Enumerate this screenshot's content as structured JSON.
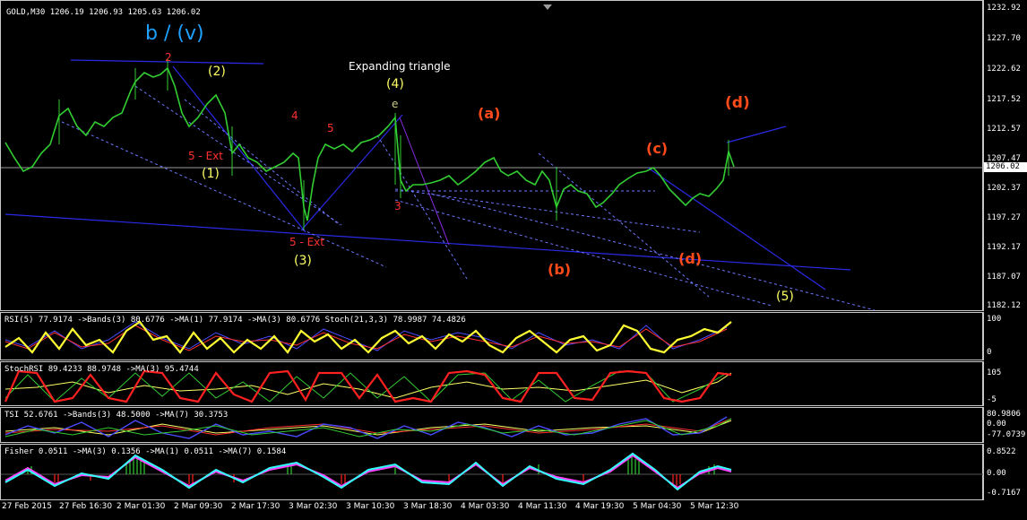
{
  "chart": {
    "title": "GOLD,M30  1206.19 1206.93 1205.63 1206.02",
    "current_price": "1206.02",
    "price_ticks": [
      "1232.92",
      "1227.70",
      "1222.62",
      "1217.52",
      "1212.57",
      "1207.47",
      "1202.37",
      "1197.27",
      "1192.17",
      "1187.07",
      "1182.12"
    ],
    "time_labels": [
      "27 Feb 2015",
      "27 Feb 16:30",
      "2 Mar 01:30",
      "2 Mar 09:30",
      "2 Mar 17:30",
      "3 Mar 02:30",
      "3 Mar 10:30",
      "3 Mar 18:30",
      "4 Mar 03:30",
      "4 Mar 11:30",
      "4 Mar 19:30",
      "5 Mar 04:30",
      "5 Mar 12:30"
    ],
    "annotations": {
      "bv": "b / (v)",
      "expanding": "Expanding triangle",
      "w4": "(4)",
      "w2": "(2)",
      "w1": "(1)",
      "w3": "(3)",
      "w5": "(5)",
      "a": "(a)",
      "b": "(b)",
      "c": "(c)",
      "d": "(d)",
      "d2": "(d)",
      "ext1": "5 - Ext",
      "ext2": "5 - Ext",
      "e": "e",
      "n4": "4",
      "n5": "5",
      "n2": "2",
      "n3": "3"
    }
  },
  "indicators": {
    "rsi": {
      "label": "RSI(5) 77.9174  ->Bands(3) 80.6776  ->MA(1) 77.9174  ->MA(3) 80.6776  Stoch(21,3,3) 78.9987 74.4826",
      "ticks": [
        "100",
        "0"
      ]
    },
    "stochrsi": {
      "label": "StochRSI 89.4233 88.9748  ->MA(3) 95.4744",
      "ticks": [
        "105",
        "-5"
      ]
    },
    "tsi": {
      "label": "TSI 52.6761  ->Bands(3) 48.5000  ->MA(7) 30.3753",
      "ticks": [
        "80.9806",
        "0.00",
        "-77.0739"
      ]
    },
    "fisher": {
      "label": "Fisher 0.0511  ->MA(3) 0.1356  ->MA(1) 0.0511  ->MA(7) 0.1584",
      "ticks": [
        "0.8522",
        "0.00",
        "-0.7167"
      ]
    }
  },
  "colors": {
    "background": "#000000",
    "candles": "#32cd32",
    "trendline": "#2020c8",
    "wave_red": "#ff3030",
    "wave_yellow": "#ffff66",
    "bv_blue": "#1ea0ff"
  }
}
